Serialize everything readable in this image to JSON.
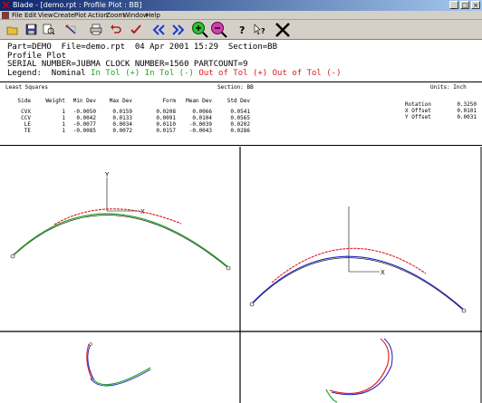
{
  "window": {
    "title": "Blade - [demo.rpt : Profile Plot : BB]"
  },
  "menu": [
    "File",
    "Edit",
    "View",
    "Create",
    "Plot",
    "Action",
    "Zoom",
    "Window",
    "Help"
  ],
  "toolbar": {
    "icons": [
      "open-folder-icon",
      "save-icon",
      "preview-icon",
      "measure-icon",
      "print-icon",
      "undo-icon",
      "checkmark-icon",
      "previous-icon",
      "next-icon",
      "zoom-in-icon",
      "zoom-out-icon",
      "help-icon",
      "context-help-icon",
      "close-x-icon"
    ]
  },
  "header": {
    "line1": "Part=DEMO  File=demo.rpt  04 Apr 2001 15:29  Section=BB",
    "line2": "Profile Plot",
    "line3": "SERIAL NUMBER=JUBMA CLOCK NUMBER=1560 PARTCOUNT=9",
    "legend_label": "Legend:  ",
    "legend": [
      {
        "text": "Nominal",
        "color": "#000000"
      },
      {
        "text": "In Tol (+)",
        "color": "#1ea51e"
      },
      {
        "text": "In Tol (-)",
        "color": "#1ea51e"
      },
      {
        "text": "Out of Tol (+)",
        "color": "#e01818"
      },
      {
        "text": "Out of Tol (-)",
        "color": "#e01818"
      }
    ]
  },
  "stats": {
    "method": "Least Squares",
    "section": "Section: BB",
    "units": "Units: Inch",
    "columns": [
      "Side",
      "Weight",
      "Min Dev",
      "Max Dev",
      "Form",
      "Mean Dev",
      "Std Dev"
    ],
    "rows": [
      [
        "CVX",
        "1",
        "-0.0050",
        "0.0159",
        "0.0208",
        "0.0066",
        "0.0541"
      ],
      [
        "CCV",
        "1",
        "0.0042",
        "0.0133",
        "0.0091",
        "0.0104",
        "0.0565"
      ],
      [
        "LE",
        "1",
        "-0.0077",
        "0.0034",
        "0.0110",
        "-0.0039",
        "0.0202"
      ],
      [
        "TE",
        "1",
        "-0.0085",
        "0.0072",
        "0.0157",
        "-0.0043",
        "0.0286"
      ]
    ],
    "offsets": [
      {
        "label": "Rotation",
        "value": "0.3250"
      },
      {
        "label": "X Offset",
        "value": "0.0101"
      },
      {
        "label": "Y Offset",
        "value": "0.0031"
      }
    ]
  },
  "plots": {
    "axis_x": "X",
    "axis_y": "Y",
    "colors": {
      "nominal": "#000000",
      "in_tol": "#1ea51e",
      "out_tol": "#e01818",
      "measured": "#1c1cc8"
    }
  }
}
